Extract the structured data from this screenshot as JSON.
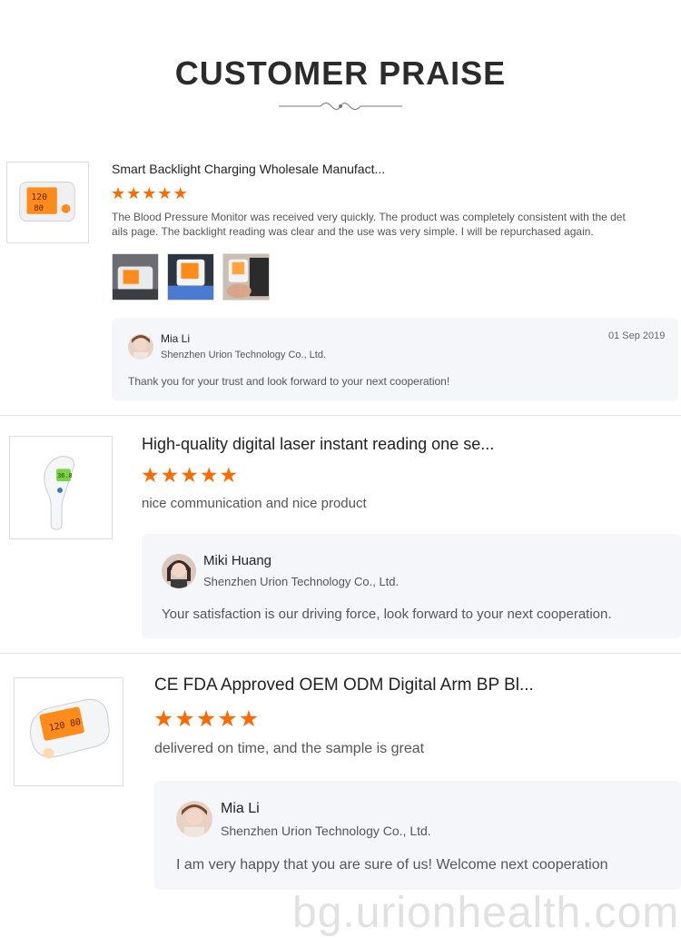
{
  "header": {
    "title": "CUSTOMER PRAISE"
  },
  "reviews": [
    {
      "product_title": "Smart Backlight Charging Wholesale Manufact...",
      "stars": 5,
      "text_line1": "The Blood Pressure Monitor was received very quickly. The product was completely consistent with the det",
      "text_line2": "ails page. The backlight reading was clear and the use was very simple. I will be repurchased again.",
      "reply": {
        "name": "Mia Li",
        "company": "Shenzhen Urion Technology Co., Ltd.",
        "date": "01 Sep 2019",
        "text": "Thank you for your trust and look forward to your next cooperation!"
      }
    },
    {
      "product_title": "High-quality digital laser instant reading one se...",
      "stars": 5,
      "text": "nice communication and nice product",
      "reply": {
        "name": "Miki Huang",
        "company": "Shenzhen Urion Technology Co., Ltd.",
        "text": "Your satisfaction is our driving force, look forward to your next cooperation."
      }
    },
    {
      "product_title": "CE FDA Approved OEM ODM Digital Arm BP Bl...",
      "stars": 5,
      "text": "delivered on time, and the sample is great",
      "reply": {
        "name": "Mia Li",
        "company": "Shenzhen Urion Technology Co., Ltd.",
        "text": "I am very happy that you are sure of us! Welcome next cooperation"
      }
    }
  ],
  "watermark": "bg.urionhealth.com",
  "colors": {
    "star": "#ff6a00",
    "reply_bg": "#f5f6fa",
    "divider": "#e3e3e3"
  }
}
